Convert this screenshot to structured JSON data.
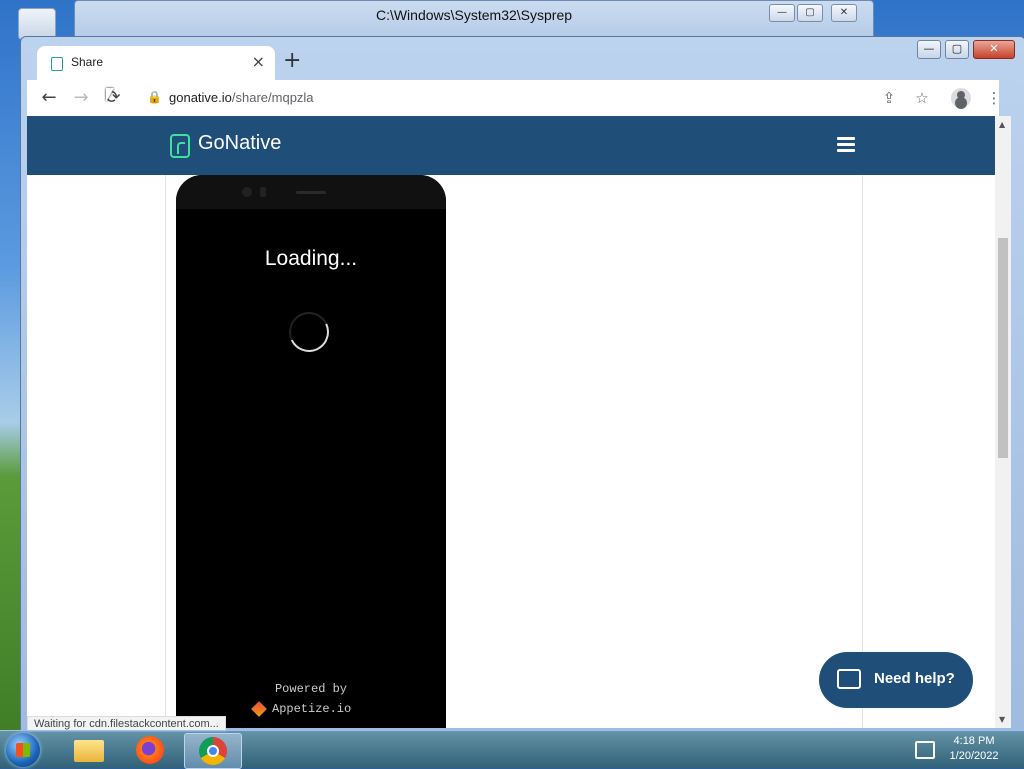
{
  "background_window": {
    "title": "C:\\Windows\\System32\\Sysprep",
    "controls": [
      "—",
      "▢",
      "✕"
    ]
  },
  "browser": {
    "tab": {
      "title": "Share",
      "close": "×"
    },
    "new_tab": "+",
    "window_controls": {
      "minimize": "—",
      "maximize": "▢",
      "close": "✕"
    },
    "nav": {
      "back": "←",
      "forward": "→",
      "reload": "⟳"
    },
    "url": {
      "host": "gonative.io",
      "path": "/share/mqpzla"
    },
    "toolbar_icons": {
      "share": "⇪",
      "bookmark": "☆",
      "menu": "⋮"
    },
    "status_text": "Waiting for cdn.filestackcontent.com..."
  },
  "page": {
    "brand": "GoNative",
    "phone": {
      "loading_text": "Loading...",
      "powered_by": "Powered by",
      "appetize": "Appetize.io"
    },
    "help_button": "Need help?"
  },
  "taskbar": {
    "clock_time": "4:18 PM",
    "clock_date": "1/20/2022"
  },
  "colors": {
    "navbar": "#1f4e79",
    "logo_accent": "#40e0a0",
    "help_button": "#1f4e79"
  }
}
